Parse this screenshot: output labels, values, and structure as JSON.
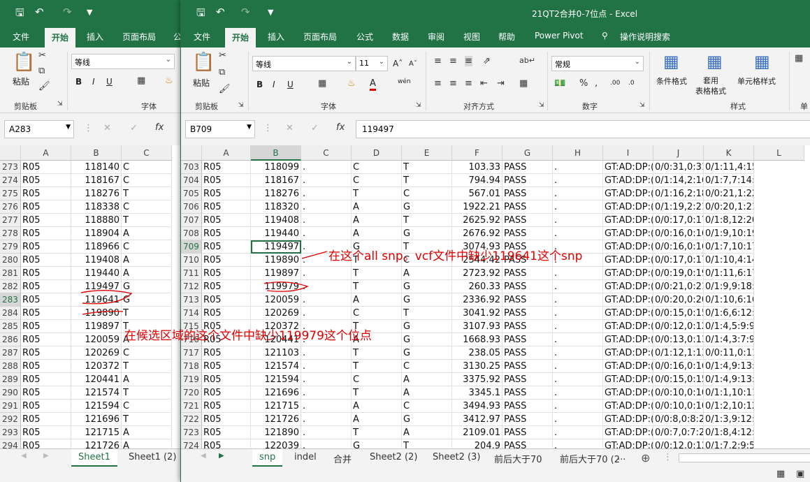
{
  "back_window": {
    "tabs": [
      "文件",
      "开始",
      "插入",
      "页面布局",
      "公"
    ],
    "active_tab": "开始",
    "ribbon": {
      "paste": "粘贴",
      "clipboard": "剪贴板",
      "font": "等线",
      "font_group": "字体",
      "bold": "B",
      "italic": "I",
      "underline": "U"
    },
    "name_box": "A283",
    "columns": [
      "A",
      "B",
      "C"
    ],
    "rows": [
      [
        "273",
        "R05",
        "118140",
        "C",
        "T"
      ],
      [
        "274",
        "R05",
        "118167",
        "C",
        "T"
      ],
      [
        "275",
        "R05",
        "118276",
        "T",
        "C"
      ],
      [
        "276",
        "R05",
        "118338",
        "C",
        "T"
      ],
      [
        "277",
        "R05",
        "118880",
        "T",
        "A"
      ],
      [
        "278",
        "R05",
        "118904",
        "A",
        "G"
      ],
      [
        "279",
        "R05",
        "118966",
        "C",
        "T"
      ],
      [
        "280",
        "R05",
        "119408",
        "A",
        "T"
      ],
      [
        "281",
        "R05",
        "119440",
        "A",
        "G"
      ],
      [
        "282",
        "R05",
        "119497",
        "G",
        "T"
      ],
      [
        "283",
        "R05",
        "119641",
        "G",
        "A"
      ],
      [
        "284",
        "R05",
        "119890",
        "T",
        "C"
      ],
      [
        "285",
        "R05",
        "119897",
        "T",
        "C"
      ],
      [
        "286",
        "R05",
        "120059",
        "A",
        "G"
      ],
      [
        "287",
        "R05",
        "120269",
        "C",
        "T"
      ],
      [
        "288",
        "R05",
        "120372",
        "T",
        "G"
      ],
      [
        "289",
        "R05",
        "120441",
        "A",
        "G"
      ],
      [
        "290",
        "R05",
        "121574",
        "T",
        "C"
      ],
      [
        "291",
        "R05",
        "121594",
        "C",
        "A"
      ],
      [
        "292",
        "R05",
        "121696",
        "T",
        "A"
      ],
      [
        "293",
        "R05",
        "121715",
        "A",
        "C"
      ],
      [
        "294",
        "R05",
        "121726",
        "A",
        "G"
      ]
    ],
    "sheet_tabs": [
      "Sheet1",
      "Sheet1 (2)"
    ],
    "active_sheet": "Sheet1"
  },
  "front_window": {
    "title": "21QT2合并0-7位点  -  Excel",
    "tabs": [
      "文件",
      "开始",
      "插入",
      "页面布局",
      "公式",
      "数据",
      "审阅",
      "视图",
      "帮助",
      "Power Pivot"
    ],
    "active_tab": "开始",
    "tell_me": "操作说明搜索",
    "ribbon": {
      "paste": "粘贴",
      "clipboard": "剪贴板",
      "font_name": "等线",
      "font_size": "11",
      "font_group": "字体",
      "align_group": "对齐方式",
      "number_format": "常规",
      "number_group": "数字",
      "cond_format": "条件格式",
      "table_format": "套用\n表格格式",
      "cell_style": "单元格样式",
      "style_group": "样式",
      "cells_group": "单"
    },
    "name_box": "B709",
    "formula_value": "119497",
    "columns": [
      "A",
      "B",
      "C",
      "D",
      "E",
      "F",
      "G",
      "H",
      "I",
      "J",
      "K",
      "L"
    ],
    "rows": [
      [
        "703",
        "R05",
        "118099",
        ".",
        "C",
        "T",
        "103.33",
        "PASS",
        ".",
        "GT:AD:DP:(",
        "0/0:31,0:31",
        "0/1:11,4:15:99:135,0,44"
      ],
      [
        "704",
        "R05",
        "118167",
        ".",
        "C",
        "T",
        "794.94",
        "PASS",
        ".",
        "GT:AD:DP:(",
        "0/1:14,2:16",
        "0/1:7,7:14:99:193,0,337"
      ],
      [
        "705",
        "R05",
        "118276",
        ".",
        "T",
        "C",
        "567.01",
        "PASS",
        ".",
        "GT:AD:DP:(",
        "0/1:16,2:18",
        "0/0:21,1:22:21:0,21,977"
      ],
      [
        "706",
        "R05",
        "118320",
        ".",
        "A",
        "G",
        "1922.21",
        "PASS",
        ".",
        "GT:AD:DP:(",
        "0/1:19,2:21",
        "0/0:20,1:21:18:0,18,786"
      ],
      [
        "707",
        "R05",
        "119408",
        ".",
        "A",
        "T",
        "2625.92",
        "PASS",
        ".",
        "GT:AD:DP:(",
        "0/0:17,0:17",
        "0/1:8,12:20:99:409,0,274"
      ],
      [
        "708",
        "R05",
        "119440",
        ".",
        "A",
        "G",
        "2676.92",
        "PASS",
        ".",
        "GT:AD:DP:(",
        "0/0:16,0:16",
        "0/1:9,10:19:99:332,0,319"
      ],
      [
        "709",
        "R05",
        "119497",
        ".",
        "G",
        "T",
        "3074.93",
        "PASS",
        ".",
        "GT:AD:DP:(",
        "0/0:16,0:16",
        "0/1:7,10:17:99:335,0,242"
      ],
      [
        "710",
        "R05",
        "119890",
        ".",
        "T",
        "C",
        "2544.42",
        "PASS",
        ".",
        "GT:AD:DP:(",
        "0/0:17,0:17",
        "0/1:10,4:14:99:138,0,408"
      ],
      [
        "711",
        "R05",
        "119897",
        ".",
        "T",
        "A",
        "2723.92",
        "PASS",
        ".",
        "GT:AD:DP:(",
        "0/0:19,0:19",
        "0/1:11,6:17:99:212,0,441"
      ],
      [
        "712",
        "R05",
        "119979",
        ".",
        "T",
        "G",
        "260.33",
        "PASS",
        ".",
        "GT:AD:DP:(",
        "0/0:21,0:21",
        "0/1:9,9:18:99:292,0,322"
      ],
      [
        "713",
        "R05",
        "120059",
        ".",
        "A",
        "G",
        "2336.92",
        "PASS",
        ".",
        "GT:AD:DP:(",
        "0/0:20,0:20",
        "0/1:10,6:16:99:168,0,336"
      ],
      [
        "714",
        "R05",
        "120269",
        ".",
        "C",
        "T",
        "3041.92",
        "PASS",
        ".",
        "GT:AD:DP:(",
        "0/0:15,0:15",
        "0/1:6,6:12:99:228,0,382"
      ],
      [
        "715",
        "R05",
        "120372",
        ".",
        "T",
        "G",
        "3107.93",
        "PASS",
        ".",
        "GT:AD:DP:(",
        "0/0:12,0:12",
        "0/1:4,5:9:99:198,0,153"
      ],
      [
        "716",
        "R05",
        "120441",
        ".",
        "A",
        "G",
        "1668.93",
        "PASS",
        ".",
        "GT:AD:DP:(",
        "0/0:13,0:13",
        "0/1:4,3:7:99:114,0,159"
      ],
      [
        "717",
        "R05",
        "121103",
        ".",
        "T",
        "G",
        "238.05",
        "PASS",
        ".",
        "GT:AD:DP:(",
        "0/1:12,1:13",
        "0/0:11,0:11:36:0,36,508"
      ],
      [
        "718",
        "R05",
        "121574",
        ".",
        "T",
        "C",
        "3130.25",
        "PASS",
        ".",
        "GT:AD:DP:(",
        "0/0:16,0:16",
        "0/1:4,9:13:99:363,0,141"
      ],
      [
        "719",
        "R05",
        "121594",
        ".",
        "C",
        "A",
        "3375.92",
        "PASS",
        ".",
        "GT:AD:DP:(",
        "0/0:15,0:15",
        "0/1:4,9:13:99:366,0,141"
      ],
      [
        "720",
        "R05",
        "121696",
        ".",
        "T",
        "A",
        "3345.1",
        "PASS",
        ".",
        "GT:AD:DP:(",
        "0/0:10,0:10",
        "0/1:1,10:11:12:398,0,12"
      ],
      [
        "721",
        "R05",
        "121715",
        ".",
        "A",
        "C",
        "3494.93",
        "PASS",
        ".",
        "GT:AD:DP:(",
        "0/0:10,0:10",
        "0/1:2,10:12:93:411,0,93"
      ],
      [
        "722",
        "R05",
        "121726",
        ".",
        "A",
        "G",
        "3412.97",
        "PASS",
        ".",
        "GT:AD:DP:(",
        "0/0:8,0:8:24",
        "0/1:3,9:12:96:366,0,96"
      ],
      [
        "723",
        "R05",
        "121890",
        ".",
        "T",
        "A",
        "2109.01",
        "PASS",
        ".",
        "GT:AD:DP:(",
        "0/0:7,0:7:2",
        "0/1:8,4:12:99:131,0,286"
      ],
      [
        "724",
        "R05",
        "122039",
        ".",
        "G",
        "T",
        "204.9",
        "PASS",
        ".",
        "GT:AD:DP:(",
        "0/0:12,0:12",
        "0/1:7,2:9:56:56,0,265"
      ]
    ],
    "selected_cell": "B709",
    "sheet_tabs": [
      "snp",
      "indel",
      "合并",
      "Sheet2 (2)",
      "Sheet2 (3)",
      "前后大于70",
      "前后大于70 (2",
      "..."
    ],
    "active_sheet": "snp"
  },
  "annotations": {
    "top": "在这个all snp。vcf文件中缺少119641这个snp",
    "bottom": "在候选区域的这个文件中缺少119979这个位点"
  },
  "colors": {
    "excel_green": "#217346",
    "annotation_red": "#e00000"
  }
}
